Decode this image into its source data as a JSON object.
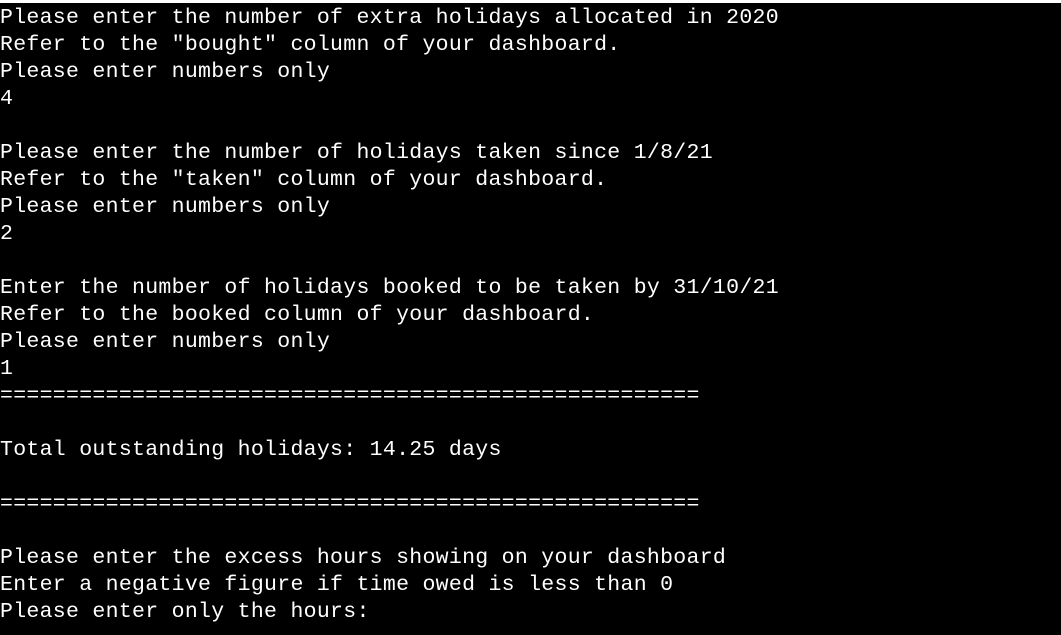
{
  "terminal": {
    "lines": [
      "Please enter the number of extra holidays allocated in 2020",
      "Refer to the \"bought\" column of your dashboard.",
      "Please enter numbers only",
      "4",
      "",
      "Please enter the number of holidays taken since 1/8/21",
      "Refer to the \"taken\" column of your dashboard.",
      "Please enter numbers only",
      "2",
      "",
      "Enter the number of holidays booked to be taken by 31/10/21",
      "Refer to the booked column of your dashboard.",
      "Please enter numbers only",
      "1",
      "=====================================================",
      "",
      "Total outstanding holidays: 14.25 days",
      "",
      "=====================================================",
      "",
      "Please enter the excess hours showing on your dashboard",
      "Enter a negative figure if time owed is less than 0",
      "Please enter only the hours:"
    ]
  }
}
